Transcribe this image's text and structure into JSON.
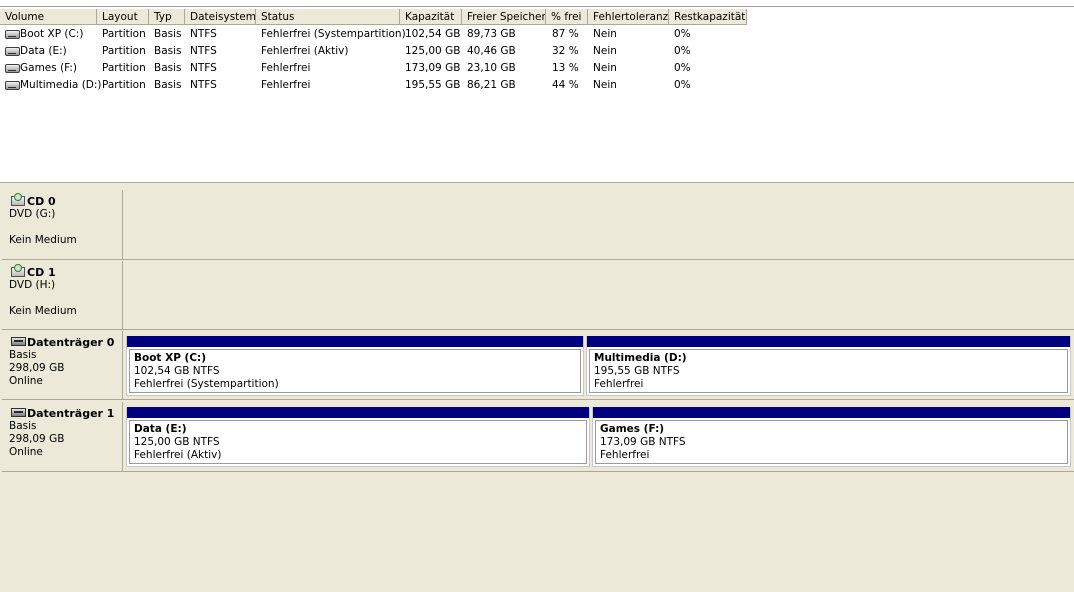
{
  "list": {
    "columns": [
      {
        "label": "Volume"
      },
      {
        "label": "Layout"
      },
      {
        "label": "Typ"
      },
      {
        "label": "Dateisystem"
      },
      {
        "label": "Status"
      },
      {
        "label": "Kapazität"
      },
      {
        "label": "Freier Speicher"
      },
      {
        "label": "% frei"
      },
      {
        "label": "Fehlertoleranz"
      },
      {
        "label": "Restkapazität"
      }
    ],
    "rows": [
      {
        "volume": "Boot XP (C:)",
        "layout": "Partition",
        "typ": "Basis",
        "fs": "NTFS",
        "status": "Fehlerfrei (Systempartition)",
        "kapazitaet": "102,54 GB",
        "frei": "89,73 GB",
        "prozent": "87 %",
        "fehlertoleranz": "Nein",
        "rest": "0%"
      },
      {
        "volume": "Data (E:)",
        "layout": "Partition",
        "typ": "Basis",
        "fs": "NTFS",
        "status": "Fehlerfrei (Aktiv)",
        "kapazitaet": "125,00 GB",
        "frei": "40,46 GB",
        "prozent": "32 %",
        "fehlertoleranz": "Nein",
        "rest": "0%"
      },
      {
        "volume": "Games (F:)",
        "layout": "Partition",
        "typ": "Basis",
        "fs": "NTFS",
        "status": "Fehlerfrei",
        "kapazitaet": "173,09 GB",
        "frei": "23,10 GB",
        "prozent": "13 %",
        "fehlertoleranz": "Nein",
        "rest": "0%"
      },
      {
        "volume": "Multimedia (D:)",
        "layout": "Partition",
        "typ": "Basis",
        "fs": "NTFS",
        "status": "Fehlerfrei",
        "kapazitaet": "195,55 GB",
        "frei": "86,21 GB",
        "prozent": "44 %",
        "fehlertoleranz": "Nein",
        "rest": "0%"
      }
    ]
  },
  "disks": [
    {
      "title": "CD 0",
      "line1": "DVD (G:)",
      "line2": "",
      "line3": "Kein Medium",
      "icon": "cd-drive-icon"
    },
    {
      "title": "CD 1",
      "line1": "DVD (H:)",
      "line2": "",
      "line3": "Kein Medium",
      "icon": "cd-drive-icon"
    },
    {
      "title": "Datenträger 0",
      "line1": "Basis",
      "line2": "298,09 GB",
      "line3": "Online",
      "icon": "hard-disk-icon",
      "partitions": [
        {
          "name": "Boot XP  (C:)",
          "size": "102,54 GB NTFS",
          "status": "Fehlerfrei (Systempartition)"
        },
        {
          "name": "Multimedia  (D:)",
          "size": "195,55 GB NTFS",
          "status": "Fehlerfrei"
        }
      ]
    },
    {
      "title": "Datenträger 1",
      "line1": "Basis",
      "line2": "298,09 GB",
      "line3": "Online",
      "icon": "hard-disk-icon",
      "partitions": [
        {
          "name": "Data  (E:)",
          "size": "125,00 GB NTFS",
          "status": "Fehlerfrei (Aktiv)"
        },
        {
          "name": "Games  (F:)",
          "size": "173,09 GB NTFS",
          "status": "Fehlerfrei"
        }
      ]
    }
  ],
  "colors": {
    "partition_bar": "#00007f",
    "panel_bg": "#ece9d8"
  }
}
